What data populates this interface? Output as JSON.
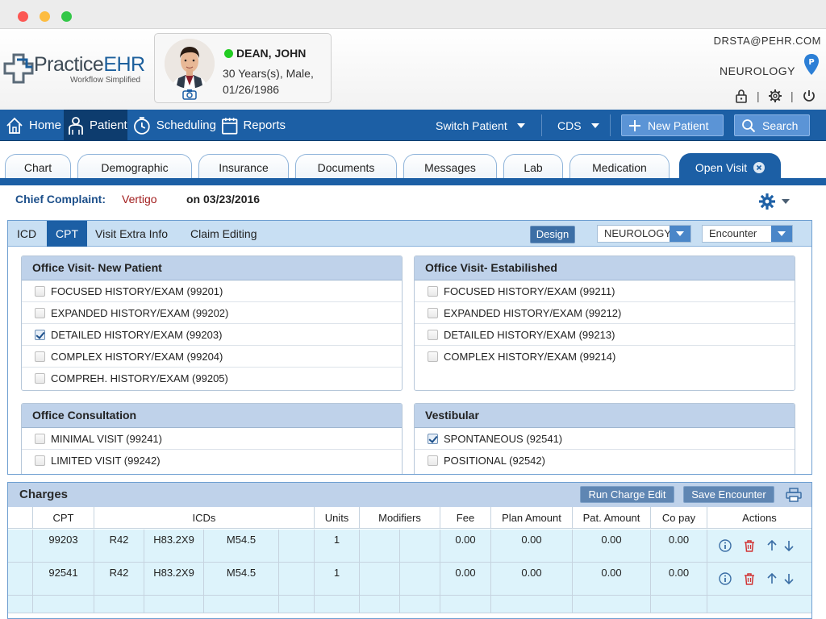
{
  "logo": {
    "brand_a": "Practice",
    "brand_b": "EHR",
    "tagline": "Workflow Simplified"
  },
  "patient": {
    "name": "DEAN, JOHN",
    "info_line1": "30 Years(s), Male,",
    "info_line2": "01/26/1986"
  },
  "user": {
    "email": "DRSTA@PEHR.COM",
    "department": "NEUROLOGY"
  },
  "nav": {
    "items": [
      {
        "label": "Home",
        "icon": "home-icon"
      },
      {
        "label": "Patient",
        "icon": "patient-icon"
      },
      {
        "label": "Scheduling",
        "icon": "clock-icon"
      },
      {
        "label": "Reports",
        "icon": "calendar-icon"
      }
    ],
    "switch_patient": "Switch Patient",
    "cds": "CDS",
    "new_patient": "New Patient",
    "search": "Search"
  },
  "tabs": [
    "Chart",
    "Demographic",
    "Insurance",
    "Documents",
    "Messages",
    "Lab",
    "Medication",
    "Open Visit"
  ],
  "complaint": {
    "label": "Chief Complaint:",
    "value": "Vertigo",
    "date_text": "on 03/23/2016"
  },
  "panel": {
    "tabs": [
      "ICD",
      "CPT",
      "Visit Extra Info",
      "Claim Editing"
    ],
    "design": "Design",
    "specialty_select": "NEUROLOGY",
    "type_select": "Encounter"
  },
  "groups": {
    "new_patient": {
      "title": "Office Visit- New Patient",
      "items": [
        {
          "label": "FOCUSED HISTORY/EXAM (99201)",
          "checked": false
        },
        {
          "label": "EXPANDED HISTORY/EXAM (99202)",
          "checked": false
        },
        {
          "label": "DETAILED HISTORY/EXAM (99203)",
          "checked": true
        },
        {
          "label": "COMPLEX HISTORY/EXAM (99204)",
          "checked": false
        },
        {
          "label": "COMPREH. HISTORY/EXAM (99205)",
          "checked": false
        }
      ]
    },
    "established": {
      "title": "Office Visit- Estabilished",
      "items": [
        {
          "label": "FOCUSED HISTORY/EXAM (99211)",
          "checked": false
        },
        {
          "label": "EXPANDED HISTORY/EXAM (99212)",
          "checked": false
        },
        {
          "label": "DETAILED HISTORY/EXAM (99213)",
          "checked": false
        },
        {
          "label": "COMPLEX HISTORY/EXAM (99214)",
          "checked": false
        }
      ]
    },
    "consultation": {
      "title": "Office Consultation",
      "items": [
        {
          "label": "MINIMAL VISIT (99241)",
          "checked": false
        },
        {
          "label": "LIMITED VISIT (99242)",
          "checked": false
        }
      ]
    },
    "vestibular": {
      "title": "Vestibular",
      "items": [
        {
          "label": "SPONTANEOUS (92541)",
          "checked": true
        },
        {
          "label": "POSITIONAL (92542)",
          "checked": false
        }
      ]
    }
  },
  "charges": {
    "title": "Charges",
    "run_charge_edit": "Run Charge Edit",
    "save_encounter": "Save Encounter",
    "columns": [
      "CPT",
      "ICDs",
      "Units",
      "Modifiers",
      "Fee",
      "Plan Amount",
      "Pat. Amount",
      "Co pay",
      "Actions"
    ],
    "rows": [
      {
        "cpt": "99203",
        "icd1": "R42",
        "icd2": "H83.2X9",
        "icd3": "M54.5",
        "units": "1",
        "fee": "0.00",
        "plan": "0.00",
        "pat": "0.00",
        "copay": "0.00"
      },
      {
        "cpt": "92541",
        "icd1": "R42",
        "icd2": "H83.2X9",
        "icd3": "M54.5",
        "units": "1",
        "fee": "0.00",
        "plan": "0.00",
        "pat": "0.00",
        "copay": "0.00"
      }
    ]
  },
  "colors": {
    "primary": "#1c5fa5",
    "nav_active": "#0d3c6e",
    "complaint": "#a11c1c",
    "online": "#22cc22"
  }
}
